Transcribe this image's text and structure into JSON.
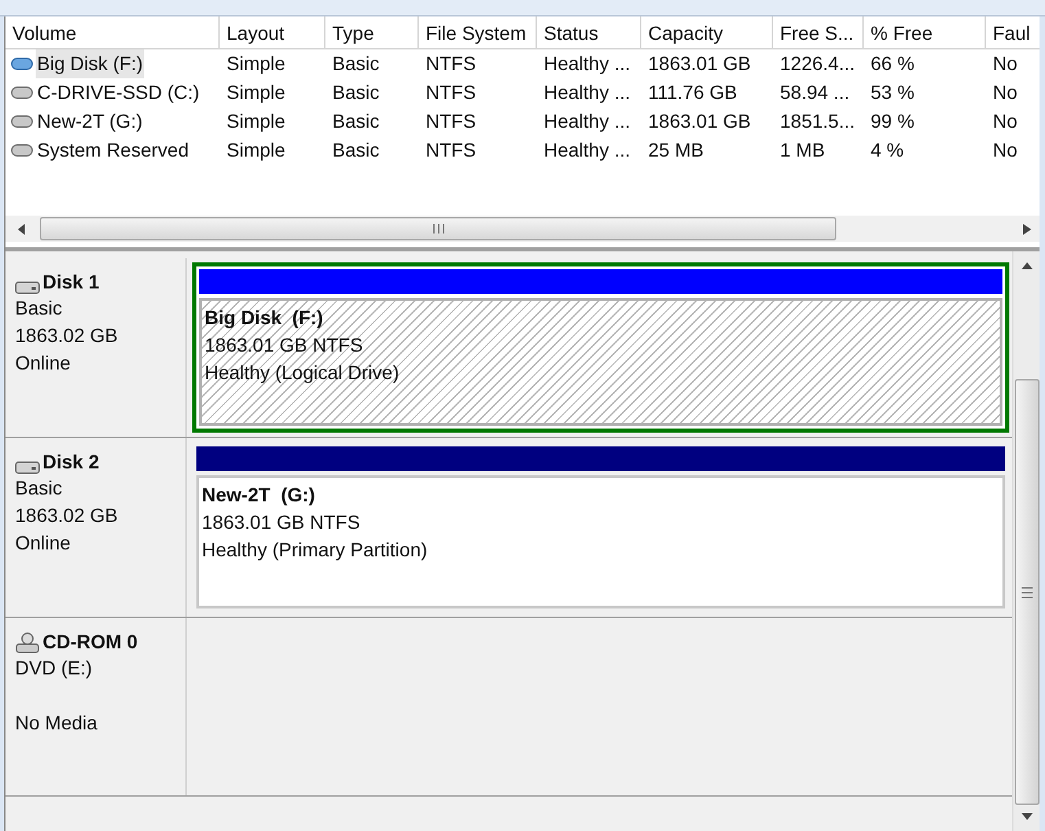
{
  "table": {
    "columns": [
      "Volume",
      "Layout",
      "Type",
      "File System",
      "Status",
      "Capacity",
      "Free S...",
      "% Free",
      "Faul"
    ],
    "rows": [
      {
        "selected": true,
        "cells": [
          "Big Disk (F:)",
          "Simple",
          "Basic",
          "NTFS",
          "Healthy ...",
          "1863.01 GB",
          "1226.4...",
          "66 %",
          "No"
        ]
      },
      {
        "selected": false,
        "cells": [
          "C-DRIVE-SSD (C:)",
          "Simple",
          "Basic",
          "NTFS",
          "Healthy ...",
          "111.76 GB",
          "58.94 ...",
          "53 %",
          "No"
        ]
      },
      {
        "selected": false,
        "cells": [
          "New-2T (G:)",
          "Simple",
          "Basic",
          "NTFS",
          "Healthy ...",
          "1863.01 GB",
          "1851.5...",
          "99 %",
          "No"
        ]
      },
      {
        "selected": false,
        "cells": [
          "System Reserved",
          "Simple",
          "Basic",
          "NTFS",
          "Healthy ...",
          "25 MB",
          "1 MB",
          "4 %",
          "No"
        ]
      }
    ]
  },
  "disks": [
    {
      "kind": "disk",
      "name": "Disk 1",
      "lines": [
        "Basic",
        "1863.02 GB",
        "Online"
      ],
      "partitions": [
        {
          "kind": "logical",
          "selected": true,
          "name": "Big Disk  (F:)",
          "size": "1863.01 GB NTFS",
          "status": "Healthy (Logical Drive)"
        }
      ]
    },
    {
      "kind": "disk",
      "name": "Disk 2",
      "lines": [
        "Basic",
        "1863.02 GB",
        "Online"
      ],
      "partitions": [
        {
          "kind": "primary",
          "selected": false,
          "name": "New-2T  (G:)",
          "size": "1863.01 GB NTFS",
          "status": "Healthy (Primary Partition)"
        }
      ]
    },
    {
      "kind": "cdrom",
      "name": "CD-ROM 0",
      "lines": [
        "DVD (E:)"
      ],
      "note": "No Media"
    }
  ]
}
